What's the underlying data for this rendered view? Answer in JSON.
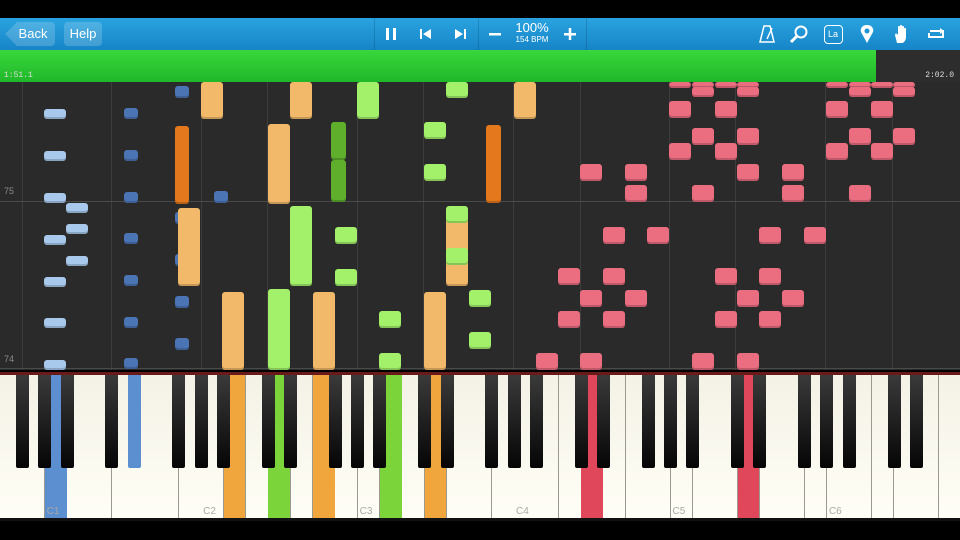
{
  "toolbar": {
    "back_label": "Back",
    "help_label": "Help",
    "tempo_percent": "100%",
    "tempo_bpm": "154 BPM",
    "controls": [
      "pause-icon",
      "skip-back-icon",
      "skip-forward-icon",
      "minus-icon",
      "plus-icon"
    ],
    "right_icons": [
      "metronome-icon",
      "zoom-icon",
      "label-icon",
      "marker-icon",
      "hand-icon",
      "loop-icon"
    ],
    "label_glyph": "La"
  },
  "progress": {
    "time_left": "1:51.1",
    "time_right": "2:02.0",
    "fraction": 0.912
  },
  "roll": {
    "measure_upper": "75",
    "measure_lower": "74"
  },
  "keyboard": {
    "octave_labels": [
      "C1",
      "C2",
      "C3",
      "C4",
      "C5",
      "C6"
    ],
    "pressed_colors": {
      "blue": "#5b8fd0",
      "orange": "#f0a63c",
      "green": "#7ad43a",
      "red": "#e0475a"
    }
  },
  "colors": {
    "toolbar": "#1f94d4",
    "progress": "#2cc933",
    "note_lightblue": "#a8c8ec",
    "note_blue": "#4b74b4",
    "note_orange": "#f2b96a",
    "note_darkorange": "#e3781d",
    "note_green": "#a3f06a",
    "note_darkgreen": "#5fae2c",
    "note_red": "#ea6d80"
  }
}
